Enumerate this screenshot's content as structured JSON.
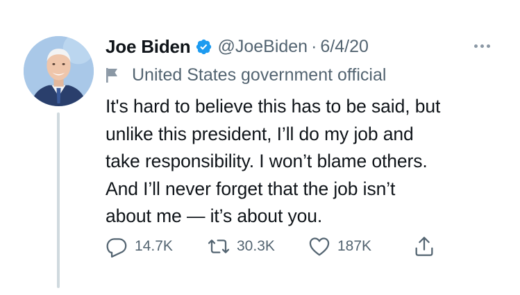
{
  "tweet": {
    "author_name": "Joe Biden",
    "handle": "@JoeBiden",
    "separator": "·",
    "date": "6/4/20",
    "label": "United States government official",
    "text_lines": [
      "It's hard to believe this has to be said, but",
      "unlike this president, I’ll do my job and",
      "take responsibility. I won’t blame others.",
      "And I’ll never forget that the job isn’t",
      "about me — it’s about you."
    ],
    "replies": "14.7K",
    "retweets": "30.3K",
    "likes": "187K"
  },
  "icons": {
    "verified": "verified-badge-icon",
    "more": "more-options-icon",
    "label": "flag-icon",
    "reply": "reply-icon",
    "retweet": "retweet-icon",
    "like": "heart-icon",
    "share": "share-icon"
  },
  "colors": {
    "verified_blue": "#1d9bf0",
    "secondary_text": "#536471",
    "primary_text": "#0f1419",
    "thread_line": "#cfd9de"
  }
}
